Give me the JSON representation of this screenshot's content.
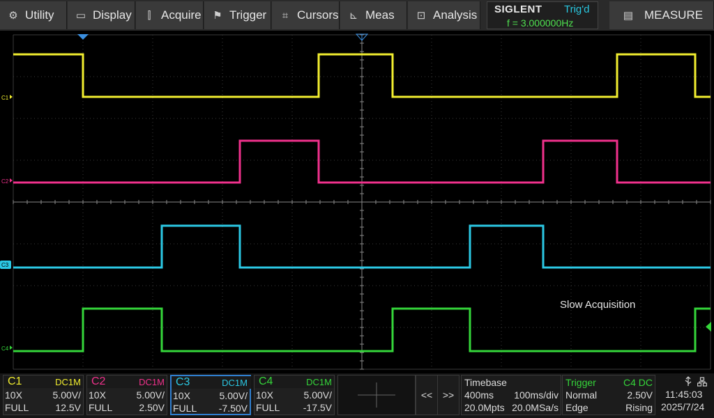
{
  "menu": {
    "items": [
      {
        "label": "Utility",
        "icon": "gear-icon",
        "glyph": "⚙"
      },
      {
        "label": "Display",
        "icon": "monitor-icon",
        "glyph": "▭"
      },
      {
        "label": "Acquire",
        "icon": "acquire-icon",
        "glyph": "⫿"
      },
      {
        "label": "Trigger",
        "icon": "flag-icon",
        "glyph": "⚑"
      },
      {
        "label": "Cursors",
        "icon": "crosshair-icon",
        "glyph": "⌗"
      },
      {
        "label": "Meas",
        "icon": "ruler-icon",
        "glyph": "⊾"
      },
      {
        "label": "Analysis",
        "icon": "analysis-icon",
        "glyph": "⊡"
      }
    ],
    "measure_label": "MEASURE",
    "measure_icon_glyph": "▤"
  },
  "brand": {
    "logo": "SIGLENT",
    "trig_status": "Trig'd",
    "frequency": "f = 3.000000Hz"
  },
  "screen": {
    "acquisition_note": "Slow Acquisition",
    "channel_markers": [
      "C1",
      "C2",
      "C3",
      "C4"
    ]
  },
  "channels": [
    {
      "name": "C1",
      "coupling": "DC1M",
      "probe": "10X",
      "scale": "5.00V/",
      "bw": "FULL",
      "offset": "12.5V",
      "color": "#f2ee2f"
    },
    {
      "name": "C2",
      "coupling": "DC1M",
      "probe": "10X",
      "scale": "5.00V/",
      "bw": "FULL",
      "offset": "2.50V",
      "color": "#f0318c"
    },
    {
      "name": "C3",
      "coupling": "DC1M",
      "probe": "10X",
      "scale": "5.00V/",
      "bw": "FULL",
      "offset": "-7.50V",
      "color": "#2bc8e4"
    },
    {
      "name": "C4",
      "coupling": "DC1M",
      "probe": "10X",
      "scale": "5.00V/",
      "bw": "FULL",
      "offset": "-17.5V",
      "color": "#35d63a"
    }
  ],
  "nav": {
    "prev": "<<",
    "next": ">>"
  },
  "timebase": {
    "title": "Timebase",
    "delay": "400ms",
    "scale": "100ms/div",
    "memory": "20.0Mpts",
    "sample_rate": "20.0MSa/s"
  },
  "trigger": {
    "title": "Trigger",
    "source": "C4 DC",
    "mode": "Normal",
    "level": "2.50V",
    "type": "Edge",
    "slope": "Rising"
  },
  "status": {
    "time": "11:45:03",
    "date": "2025/7/24"
  }
}
